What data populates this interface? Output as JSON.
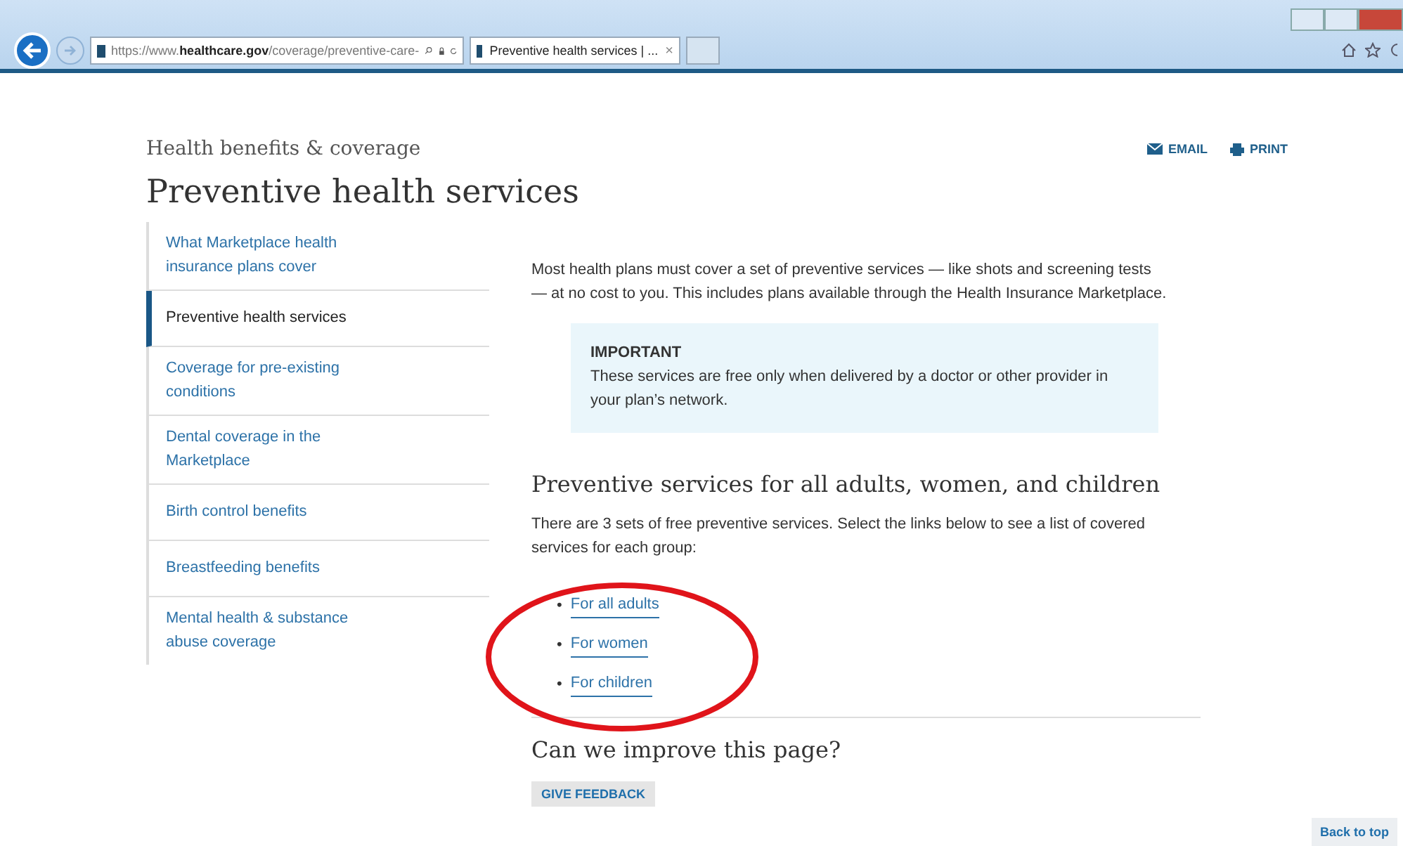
{
  "browser": {
    "url_prefix": "https://www.",
    "url_domain": "healthcare.gov",
    "url_path": "/coverage/preventive-care-",
    "tab_title": "Preventive health services | ...",
    "tab_close": "×"
  },
  "breadcrumb": "Health benefits & coverage",
  "actions": [
    {
      "kind": "email",
      "label": "EMAIL"
    },
    {
      "kind": "print",
      "label": "PRINT"
    }
  ],
  "title": "Preventive health services",
  "sidebar": {
    "items": [
      {
        "label": "What Marketplace health insurance plans cover",
        "selected": false
      },
      {
        "label": "Preventive health services",
        "selected": true
      },
      {
        "label": "Coverage for pre-existing conditions",
        "selected": false
      },
      {
        "label": "Dental coverage in the Marketplace",
        "selected": false
      },
      {
        "label": "Birth control benefits",
        "selected": false
      },
      {
        "label": "Breastfeeding benefits",
        "selected": false
      },
      {
        "label": "Mental health & substance abuse coverage",
        "selected": false
      }
    ]
  },
  "intro": "Most health plans must cover a set of preventive services — like shots and screening tests — at no cost to you. This includes plans available through the Health Insurance Marketplace.",
  "callout": {
    "heading": "IMPORTANT",
    "text": "These services are free only when delivered by a doctor or other provider in your plan’s network."
  },
  "section_heading": "Preventive services for all adults, women, and children",
  "section_text": "There are 3 sets of free preventive services. Select the links below to see a list of covered services for each group:",
  "links": [
    {
      "bullet": "•",
      "label": "For all adults"
    },
    {
      "bullet": "•",
      "label": "For women"
    },
    {
      "bullet": "•",
      "label": "For children"
    }
  ],
  "feedback_heading": "Can we improve this page?",
  "feedback_button": "GIVE FEEDBACK",
  "back_to_top": "Back to top"
}
